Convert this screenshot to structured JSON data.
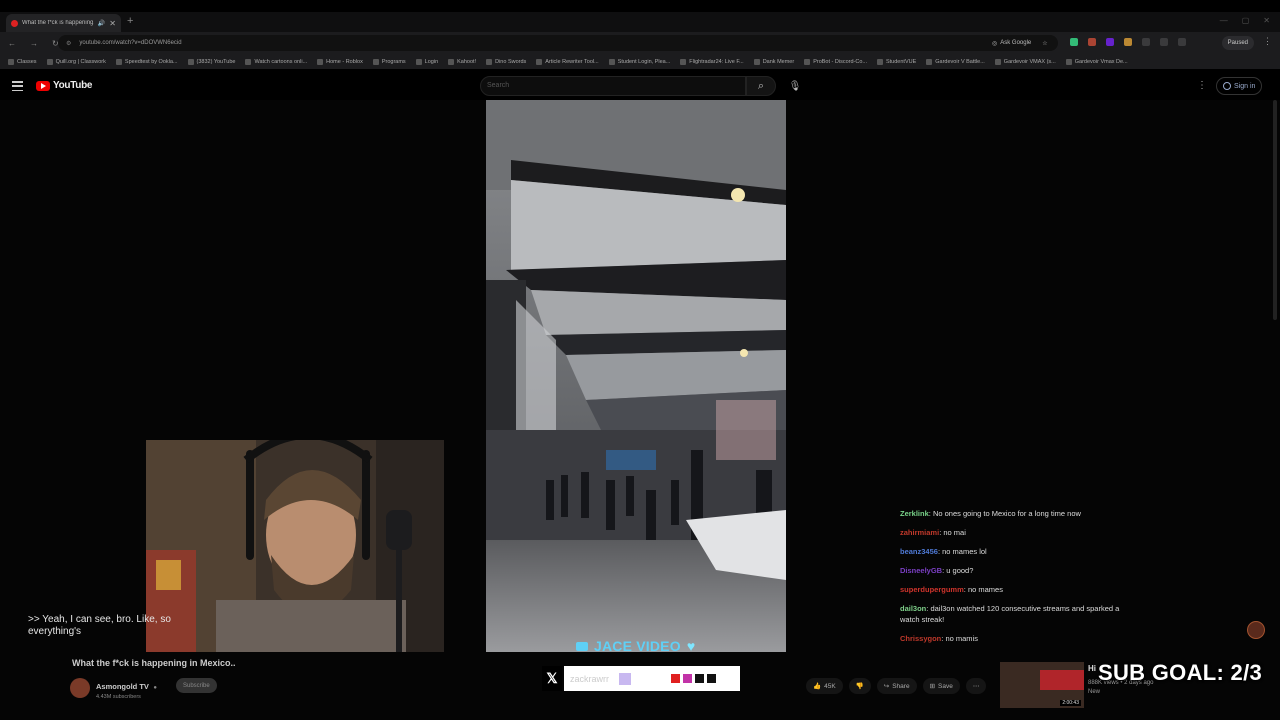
{
  "browser": {
    "tab_title": "What the f*ck is happening...",
    "url": "youtube.com/watch?v=dDOVWN6ecid",
    "ask_google": "Ask Google",
    "paused_label": "Paused",
    "bookmarks": [
      "Classes",
      "Quill.org | Classwork",
      "Speedtest by Ookla...",
      "(3832) YouTube",
      "Watch cartoons onli...",
      "Home - Roblox",
      "Programs",
      "Login",
      "Kahoot!",
      "Dino Swords",
      "Article Rewriter Tool...",
      "Student Login, Plea...",
      "Flightradar24: Live F...",
      "Dank Memer",
      "ProBot - Discord-Co...",
      "StudentVUE",
      "Gardevoir V Battle...",
      "Gardevoir VMAX (s...",
      "Gardevoir Vmax De..."
    ]
  },
  "youtube": {
    "logo_text": "YouTube",
    "search_placeholder": "Search",
    "sign_in": "Sign in",
    "video_title": "What the f*ck is happening in Mexico..",
    "channel_name": "Asmongold TV",
    "channel_subs": "4.43M subscribers",
    "subscribe": "Subscribe",
    "likes": "45K",
    "share": "Share",
    "save": "Save",
    "recommended": {
      "title": "Hi",
      "views": "888K views • 2 days ago",
      "badge": "New",
      "duration": "2:00:43"
    }
  },
  "stream": {
    "caption": ">> Yeah, I can see, bro. Like, so everything's",
    "banner": "JACE VIDEO",
    "social_handle": "zackrawrr",
    "sub_goal": "SUB GOAL: 2/3",
    "chat": [
      {
        "user": "Zerklink",
        "message": "No ones going to Mexico for a long time now",
        "color": "#79d38a"
      },
      {
        "user": "zahirmiami",
        "message": "no mai",
        "color": "#c0392b"
      },
      {
        "user": "beanz3456",
        "message": "no mames lol",
        "color": "#4f7ad6"
      },
      {
        "user": "DisneelyGB",
        "message": "u good?",
        "color": "#7b3fc4"
      },
      {
        "user": "superdupergumm",
        "message": "no mames",
        "color": "#d0342c"
      },
      {
        "user": "dail3on",
        "message": "dail3on watched 120 consecutive streams and sparked a watch streak!",
        "color": "#7fd08a"
      },
      {
        "user": "Chrissygon",
        "message": "no mamis",
        "color": "#c0392b"
      }
    ]
  },
  "colors": {
    "youtube_red": "#ff0000",
    "banner_cyan": "#5fd0f6",
    "background": "#000000"
  }
}
